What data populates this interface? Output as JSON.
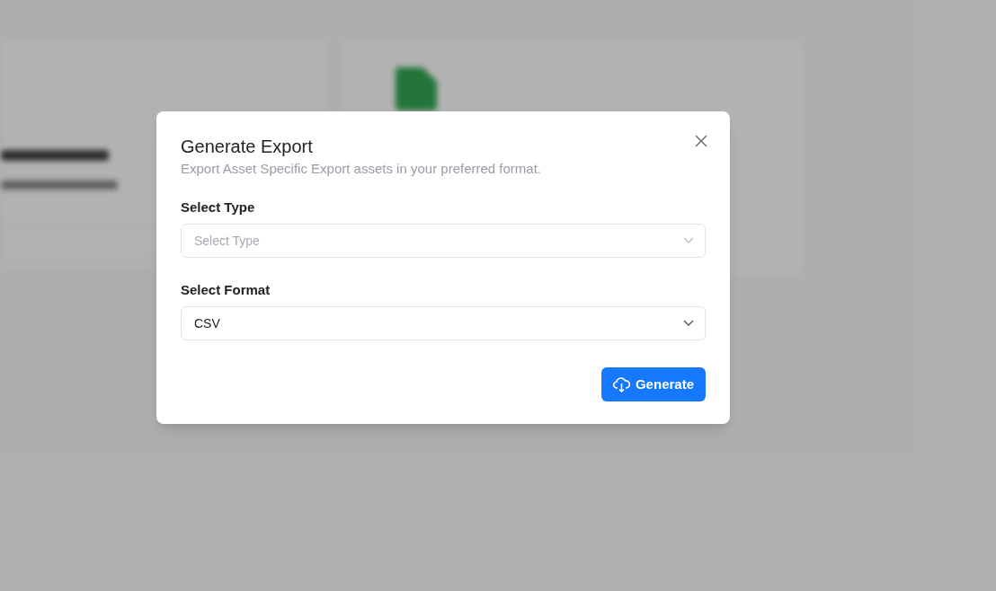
{
  "dialog": {
    "title": "Generate Export",
    "subtitle": "Export Asset Specific Export assets in your preferred format.",
    "fields": [
      {
        "label": "Select Type",
        "placeholder": "Select Type"
      },
      {
        "label": "Select Format",
        "value": "CSV"
      }
    ],
    "button": "Generate"
  }
}
